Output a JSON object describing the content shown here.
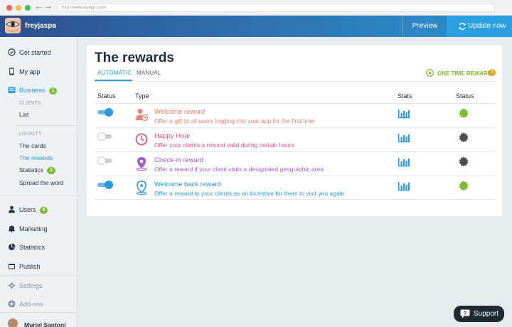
{
  "browser": {
    "url": "http://www.myapp.com/"
  },
  "topbar": {
    "account_name": "freyjaspa",
    "preview_label": "Preview",
    "update_label": "Update now"
  },
  "sidebar": {
    "get_started": "Get started",
    "my_app": "My app",
    "business": {
      "label": "Business",
      "badge": "1"
    },
    "clients_group": "CLIENTS",
    "clients_list": "List",
    "loyalty_group": "LOYALTY",
    "loyalty_items": [
      "The cards",
      "The rewards",
      "Statistics",
      "Spread the word"
    ],
    "loyalty_statistics_badge": "1",
    "users": {
      "label": "Users",
      "badge": "4"
    },
    "marketing": "Marketing",
    "statistics": "Statistics",
    "publish": "Publish",
    "settings": "Settings",
    "addons": "Add-ons",
    "user_name": "Muriel Santoni"
  },
  "main": {
    "title": "The rewards",
    "tabs": [
      "AUTOMATIC",
      "MANUAL"
    ],
    "active_tab": "AUTOMATIC",
    "one_time_reward": "ONE TIME REWARD",
    "help_glyph": "?",
    "columns": {
      "status_left": "Status",
      "type": "Type",
      "stats": "Stats",
      "status_right": "Status"
    },
    "rows": [
      {
        "title": "Welcome reward",
        "description": "Offer a gift to all users logging into your app for the first time",
        "enabled": true,
        "icon": "gift-person-icon",
        "color": "#f07e6e",
        "status_color": "#7cbd2b"
      },
      {
        "title": "Happy Hour",
        "description": "Offer your clients a reward valid during certain hours",
        "enabled": false,
        "icon": "clock-icon",
        "color": "#e6567a",
        "status_color": "#4a4f55"
      },
      {
        "title": "Check-in reward",
        "description": "Offer a reward if your client visits a designated geographic area",
        "enabled": false,
        "icon": "map-pin-icon",
        "color": "#a05bd0",
        "status_color": "#4a4f55"
      },
      {
        "title": "Welcome back reward",
        "description": "Offer a reward to your clients as an incentive for them to visit you again",
        "enabled": true,
        "icon": "star-pin-icon",
        "color": "#2a9be0",
        "status_color": "#7cbd2b"
      }
    ]
  },
  "support": {
    "label": "Support"
  },
  "colors": {
    "accent": "#2a9be0",
    "green": "#7cbd2b",
    "orange": "#f1a01c"
  }
}
